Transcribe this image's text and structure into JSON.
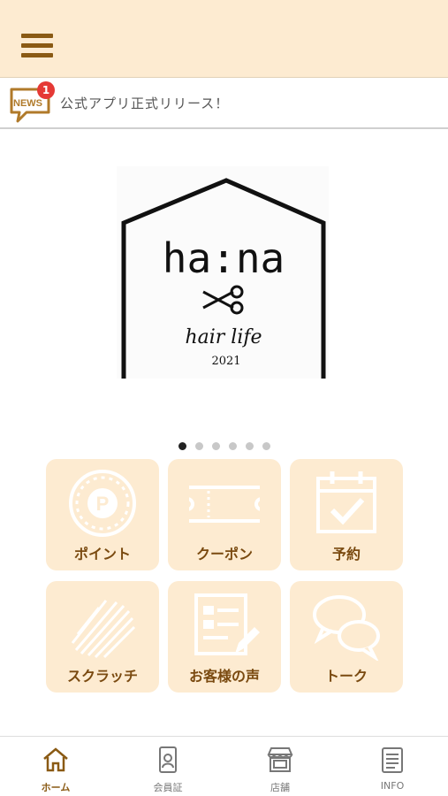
{
  "header": {
    "menu_icon": "hamburger-menu-icon"
  },
  "news": {
    "icon": "news-speech-bubble-icon",
    "icon_text": "NEWS",
    "badge_count": "1",
    "text": "公式アプリ正式リリース！"
  },
  "hero": {
    "logo_title": "ha:na",
    "logo_script": "hair life",
    "logo_year": "2021",
    "logo_icon": "scissors-icon",
    "slide_count": 6,
    "active_slide": 1
  },
  "tiles": [
    {
      "label": "ポイント",
      "icon": "point-coin-icon"
    },
    {
      "label": "クーポン",
      "icon": "coupon-ticket-icon"
    },
    {
      "label": "予約",
      "icon": "calendar-check-icon"
    },
    {
      "label": "スクラッチ",
      "icon": "scratch-icon"
    },
    {
      "label": "お客様の声",
      "icon": "review-form-icon"
    },
    {
      "label": "トーク",
      "icon": "chat-bubbles-icon"
    }
  ],
  "tabs": [
    {
      "label": "ホーム",
      "icon": "home-icon",
      "active": true
    },
    {
      "label": "会員証",
      "icon": "member-card-icon",
      "active": false
    },
    {
      "label": "店舗",
      "icon": "store-icon",
      "active": false
    },
    {
      "label": "INFO",
      "icon": "info-document-icon",
      "active": false
    }
  ],
  "colors": {
    "brand_beige": "#fdebd1",
    "brand_brown": "#8a5a14",
    "badge_red": "#e53935"
  }
}
